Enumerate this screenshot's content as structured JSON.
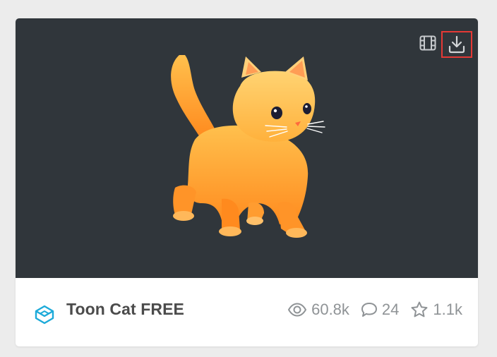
{
  "card": {
    "title": "Toon Cat FREE",
    "stats": {
      "views": "60.8k",
      "comments": "24",
      "likes": "1.1k"
    },
    "icons": {
      "video": "film-strip-icon",
      "download": "download-icon",
      "brand": "sketchfab-icon",
      "views": "eye-icon",
      "comments": "comment-icon",
      "likes": "star-icon"
    },
    "colors": {
      "thumbnail_bg": "#30363b",
      "highlight_border": "#e53935",
      "brand_blue": "#1caad9"
    }
  }
}
